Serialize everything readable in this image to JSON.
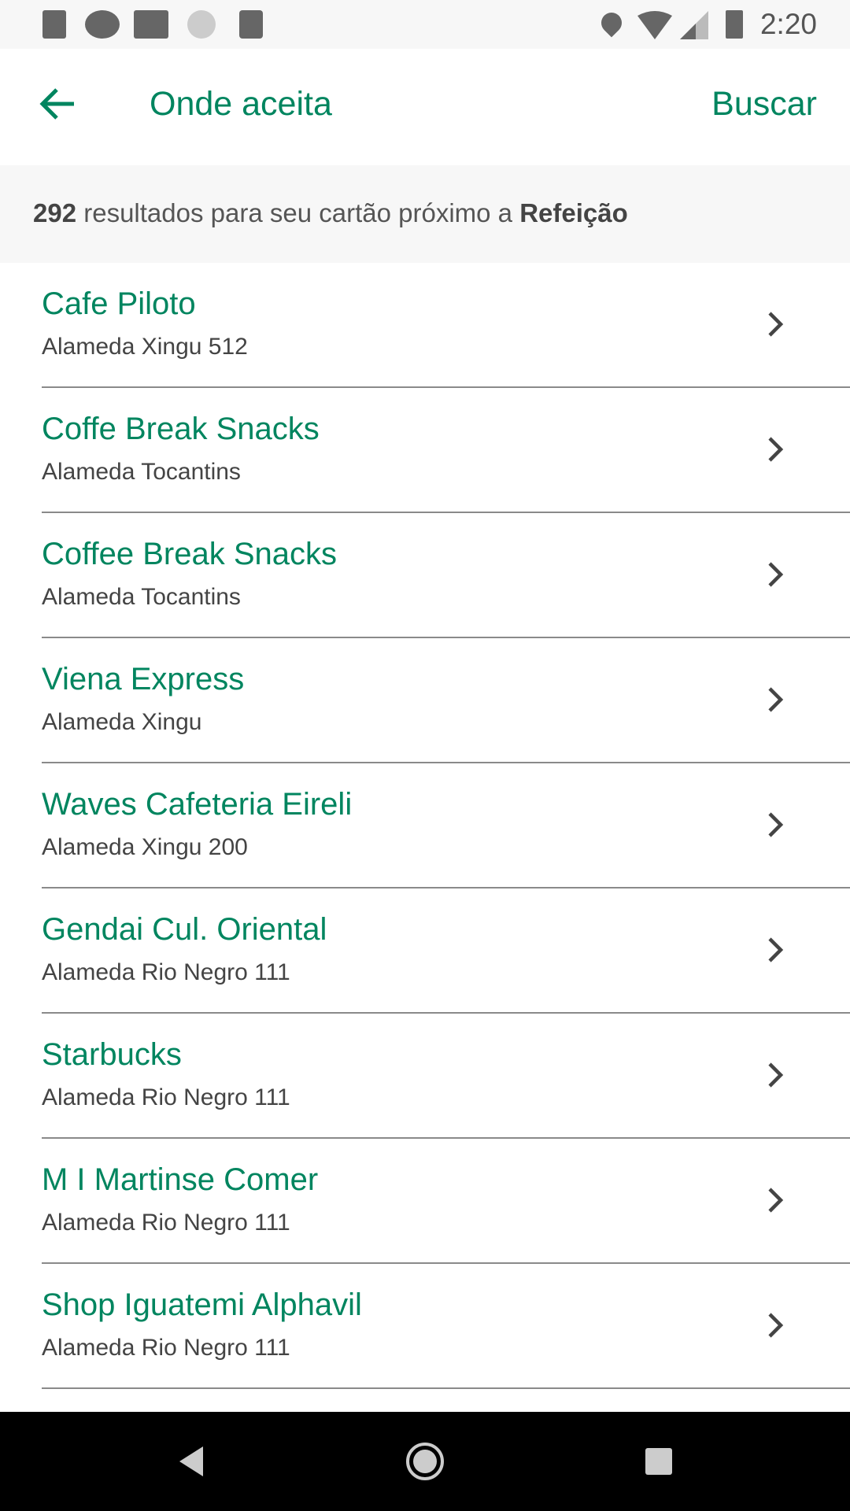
{
  "status_bar": {
    "time": "2:20",
    "icons": [
      "font-notification-icon",
      "app-notification-icon",
      "gmail-icon",
      "sync-icon",
      "sd-card-icon",
      "location-icon",
      "wifi-icon",
      "signal-icon",
      "battery-icon"
    ]
  },
  "header": {
    "title": "Onde aceita",
    "search_label": "Buscar"
  },
  "subheader": {
    "count": "292",
    "text": " resultados para seu cartão próximo a ",
    "category": "Refeição"
  },
  "results": [
    {
      "name": "Cafe Piloto",
      "address": "Alameda Xingu 512"
    },
    {
      "name": "Coffe Break Snacks",
      "address": "Alameda Tocantins"
    },
    {
      "name": "Coffee Break Snacks",
      "address": "Alameda Tocantins"
    },
    {
      "name": "Viena Express",
      "address": "Alameda Xingu"
    },
    {
      "name": "Waves Cafeteria Eireli",
      "address": "Alameda Xingu 200"
    },
    {
      "name": "Gendai Cul. Oriental",
      "address": "Alameda Rio Negro 111"
    },
    {
      "name": "Starbucks",
      "address": "Alameda Rio Negro 111"
    },
    {
      "name": "M I Martinse Comer",
      "address": "Alameda Rio Negro 111"
    },
    {
      "name": "Shop Iguatemi Alphavil",
      "address": "Alameda Rio Negro 111"
    }
  ],
  "colors": {
    "accent": "#00855f",
    "text": "#444444",
    "subheader_bg": "#f7f7f7"
  }
}
